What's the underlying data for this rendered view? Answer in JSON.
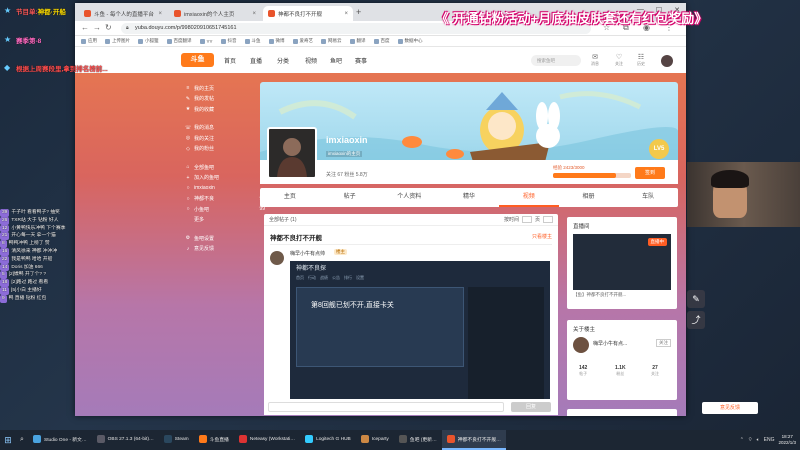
{
  "overlay": {
    "banner": "《 开通钻粉活动+月底抽皮肤套还有红包奖励》",
    "line1_prefix": "节目单:",
    "line1_value": "神都·开船",
    "line2": "赛季第-8",
    "line3": "根据上周赛段里,拿到排名榜前..."
  },
  "chat": [
    {
      "level": "39",
      "text": "千子叶 看看鸭子? 抽奖"
    },
    {
      "level": "26",
      "text": "TXR站 大于 钻粉 好人"
    },
    {
      "level": "12",
      "text": "小黄鸭快乐冲鸭 下个赛季"
    },
    {
      "level": "21",
      "text": "开心每一天 拿一个猫"
    },
    {
      "level": "8",
      "text": "鸭鸭冲鸭 上榜了 赞"
    },
    {
      "level": "16",
      "text": "清风徐来 神都 冲冲冲"
    },
    {
      "level": "22",
      "text": "我是鸭鸭 哈哈 开船"
    },
    {
      "level": "14",
      "text": "Doris 加油 666"
    },
    {
      "level": "5",
      "text": "[2]嫖鸭 开了个? ?"
    },
    {
      "level": "18",
      "text": "[2]路过 路过 看看"
    },
    {
      "level": "11",
      "text": "[5]小白 主播好"
    },
    {
      "level": "9",
      "text": "鸭 直播 钻粉 红包"
    }
  ],
  "browser": {
    "tabs": [
      {
        "label": "斗鱼 - 每个人的直播平台"
      },
      {
        "label": "imxiaoxin的个人主页"
      },
      {
        "label": "神都不良打不开舰"
      }
    ],
    "url": "yuba.douyu.com/p/998020910651745161",
    "bookmarks": [
      "应用",
      "上传图片",
      "小狐狸",
      "百度翻译",
      "YY",
      "抖音",
      "斗鱼",
      "微博",
      "爱奇艺",
      "网易云",
      "翻译",
      "百度",
      "数据中心"
    ]
  },
  "site": {
    "logo": "斗鱼",
    "nav": [
      "首页",
      "直播",
      "分类",
      "视频",
      "鱼吧",
      "赛事"
    ],
    "search_placeholder": "搜索鱼吧",
    "header_icons": [
      {
        "glyph": "✉",
        "label": "消息"
      },
      {
        "glyph": "♡",
        "label": "关注"
      },
      {
        "glyph": "☷",
        "label": "历史"
      }
    ],
    "left_menu": [
      {
        "icon": "≡",
        "label": "我的主页",
        "count": ""
      },
      {
        "icon": "✎",
        "label": "我的发帖",
        "count": ""
      },
      {
        "icon": "★",
        "label": "我的收藏",
        "count": ""
      },
      {
        "icon": "",
        "label": "",
        "count": ""
      },
      {
        "icon": "☏",
        "label": "我的消息",
        "count": ""
      },
      {
        "icon": "◎",
        "label": "我的关注",
        "count": ""
      },
      {
        "icon": "◇",
        "label": "我的粉丝",
        "count": ""
      },
      {
        "icon": "",
        "label": "",
        "count": ""
      },
      {
        "icon": "⌂",
        "label": "全部鱼吧",
        "count": ""
      },
      {
        "icon": "+",
        "label": "加入的鱼吧",
        "count": ""
      },
      {
        "icon": "○",
        "label": "imxiaoxin",
        "count": ""
      },
      {
        "icon": "○",
        "label": "神都不良",
        "count": "99"
      },
      {
        "icon": "○",
        "label": "小鱼吧",
        "count": "99"
      },
      {
        "icon": "",
        "label": "更多",
        "count": ""
      },
      {
        "icon": "",
        "label": "",
        "count": ""
      },
      {
        "icon": "⚙",
        "label": "鱼吧设置",
        "count": ""
      },
      {
        "icon": "♪",
        "label": "意见反馈",
        "count": ""
      }
    ],
    "profile": {
      "username": "imxiaoxin",
      "userid": "imxiaoxin的主页",
      "stats": "关注 67  粉丝 5.8万",
      "level": "LV5",
      "exp_label": "经验 2423/3000",
      "exp_progress": 0.81,
      "sign_button": "签到"
    },
    "profile_tabs": [
      "主页",
      "帖子",
      "个人资料",
      "精华",
      "视频",
      "相册",
      "车队"
    ],
    "active_profile_tab": 4,
    "feed": {
      "toolbar_left": "全部帖子 (1)",
      "toolbar_sort": "按时间",
      "toolbar_page": "页",
      "post_title": "神都不良打不开舰",
      "post_status": "只看楼主",
      "comment_user": "嗨早小牛有点帅",
      "comment_badge": "楼主",
      "shot_title": "神都不良探",
      "shot_tabs": [
        "首页",
        "行动",
        "战绩",
        "公告",
        "排行",
        "设置"
      ],
      "shot_line": "第8回舰已划不开,直接卡关",
      "reply_button": "回复"
    },
    "sidebar": {
      "live_title": "直播间",
      "live_pill": "直播中",
      "live_caption": "【鱼】神都不良打不开舰...",
      "fans_title": "关于楼主",
      "fan_name": "嗨早小牛有点...",
      "fan_button": "关注",
      "fan_stats": [
        {
          "value": "142",
          "label": "帖子"
        },
        {
          "value": "1.1K",
          "label": "粉丝"
        },
        {
          "value": "27",
          "label": "关注"
        }
      ]
    },
    "feedback": "意见反馈"
  },
  "taskbar": {
    "items": [
      {
        "label": "Studio One - 新文…",
        "color": "#4aa3df"
      },
      {
        "label": "OBS 27.1.3 (64-bit)…",
        "color": "#5a5a66"
      },
      {
        "label": "Steam",
        "color": "#2a475e"
      },
      {
        "label": "斗鱼直播",
        "color": "#ff7a1a"
      },
      {
        "label": "Neteasy (Workstati…",
        "color": "#d33"
      },
      {
        "label": "Logitech G HUB",
        "color": "#3cf"
      },
      {
        "label": "Iceparty",
        "color": "#c84"
      },
      {
        "label": "鱼吧 (更新…",
        "color": "#555"
      },
      {
        "label": "神都不良打不开舰…",
        "color": "#e9542c"
      }
    ],
    "active_item": 8,
    "tray_lang": "ENG",
    "time": "18:27",
    "date": "2022/1/3"
  },
  "colors": {
    "accent": "#ff5d23",
    "overlay_pink": "#d4006a"
  }
}
